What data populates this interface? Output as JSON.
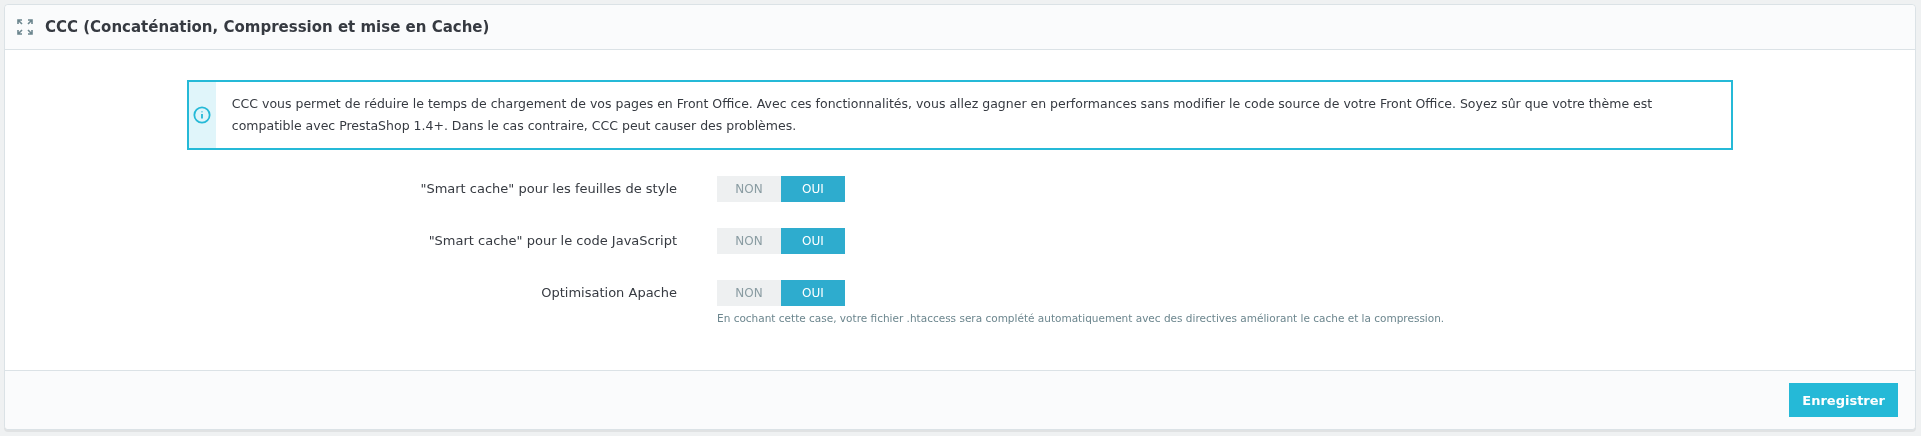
{
  "panel": {
    "title": "CCC (Concaténation, Compression et mise en Cache)"
  },
  "info": {
    "text": "CCC vous permet de réduire le temps de chargement de vos pages en Front Office. Avec ces fonctionnalités, vous allez gagner en performances sans modifier le code source de votre Front Office. Soyez sûr que votre thème est compatible avec PrestaShop 1.4+. Dans le cas contraire, CCC peut causer des problèmes."
  },
  "settings": [
    {
      "label": "\"Smart cache\" pour les feuilles de style",
      "options": [
        {
          "label": "NON",
          "selected": false
        },
        {
          "label": "OUI",
          "selected": true
        }
      ]
    },
    {
      "label": "\"Smart cache\" pour le code JavaScript",
      "options": [
        {
          "label": "NON",
          "selected": false
        },
        {
          "label": "OUI",
          "selected": true
        }
      ]
    },
    {
      "label": "Optimisation Apache",
      "options": [
        {
          "label": "NON",
          "selected": false
        },
        {
          "label": "OUI",
          "selected": true
        }
      ],
      "help": "En cochant cette case, votre fichier .htaccess sera complété automatiquement avec des directives améliorant le cache et la compression."
    }
  ],
  "footer": {
    "save_button": "Enregistrer"
  }
}
